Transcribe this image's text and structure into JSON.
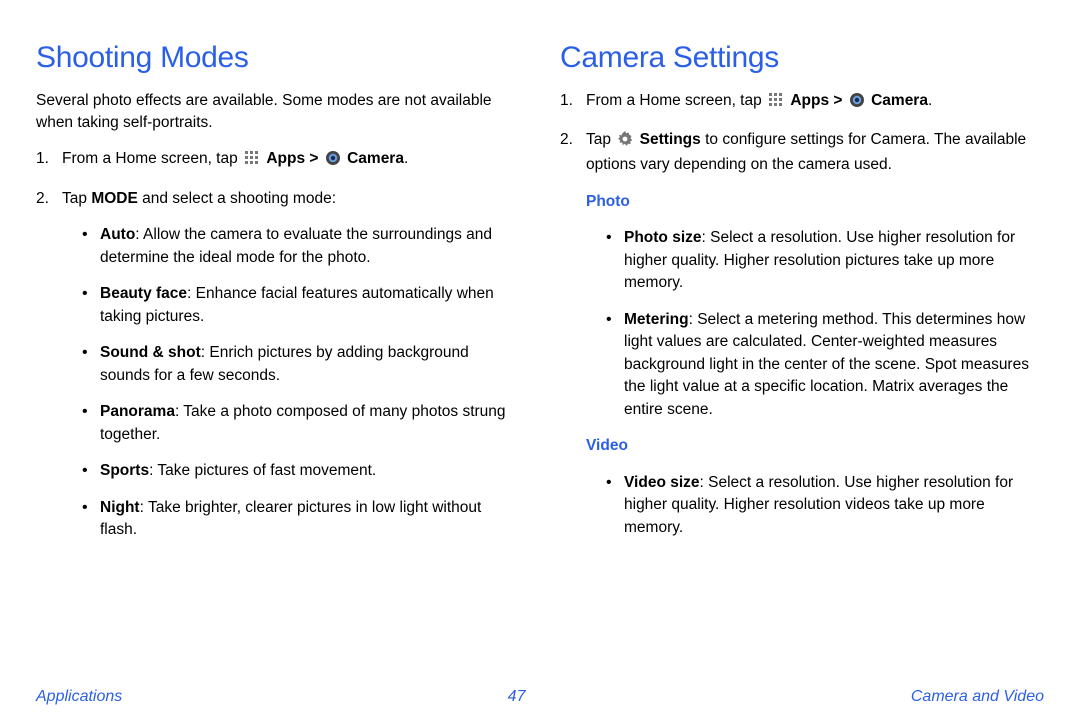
{
  "left": {
    "heading": "Shooting Modes",
    "intro": "Several photo effects are available. Some modes are not available when taking self-portraits.",
    "step1_prefix": "From a Home screen, tap ",
    "apps_label": "Apps",
    "gt": " > ",
    "camera_label": "Camera",
    "period": ".",
    "step2_prefix": "Tap ",
    "mode_label": "MODE",
    "step2_suffix": " and select a shooting mode:",
    "modes": [
      {
        "name": "Auto",
        "desc": ": Allow the camera to evaluate the surroundings and determine the ideal mode for the photo."
      },
      {
        "name": "Beauty face",
        "desc": ": Enhance facial features automatically when taking pictures."
      },
      {
        "name": "Sound & shot",
        "desc": ": Enrich pictures by adding background sounds for a few seconds."
      },
      {
        "name": "Panorama",
        "desc": ": Take a photo composed of many photos strung together."
      },
      {
        "name": "Sports",
        "desc": ": Take pictures of fast movement."
      },
      {
        "name": "Night",
        "desc": ": Take brighter, clearer pictures in low light without flash."
      }
    ]
  },
  "right": {
    "heading": "Camera Settings",
    "step1_prefix": "From a Home screen, tap ",
    "apps_label": "Apps",
    "gt": " > ",
    "camera_label": "Camera",
    "period": ".",
    "step2_prefix": "Tap ",
    "settings_label": "Settings",
    "step2_suffix": " to configure settings for Camera. The available options vary depending on the camera used.",
    "photo_head": "Photo",
    "photo_items": [
      {
        "name": "Photo size",
        "desc": ": Select a resolution. Use higher resolution for higher quality. Higher resolution pictures take up more memory."
      },
      {
        "name": "Metering",
        "desc": ": Select a metering method. This determines how light values are calculated. Center-weighted measures background light in the center of the scene. Spot measures the light value at a specific location. Matrix averages the entire scene."
      }
    ],
    "video_head": "Video",
    "video_items": [
      {
        "name": "Video size",
        "desc": ": Select a resolution. Use higher resolution for higher quality. Higher resolution videos take up more memory."
      }
    ]
  },
  "footer": {
    "left": "Applications",
    "page": "47",
    "right": "Camera and Video"
  }
}
